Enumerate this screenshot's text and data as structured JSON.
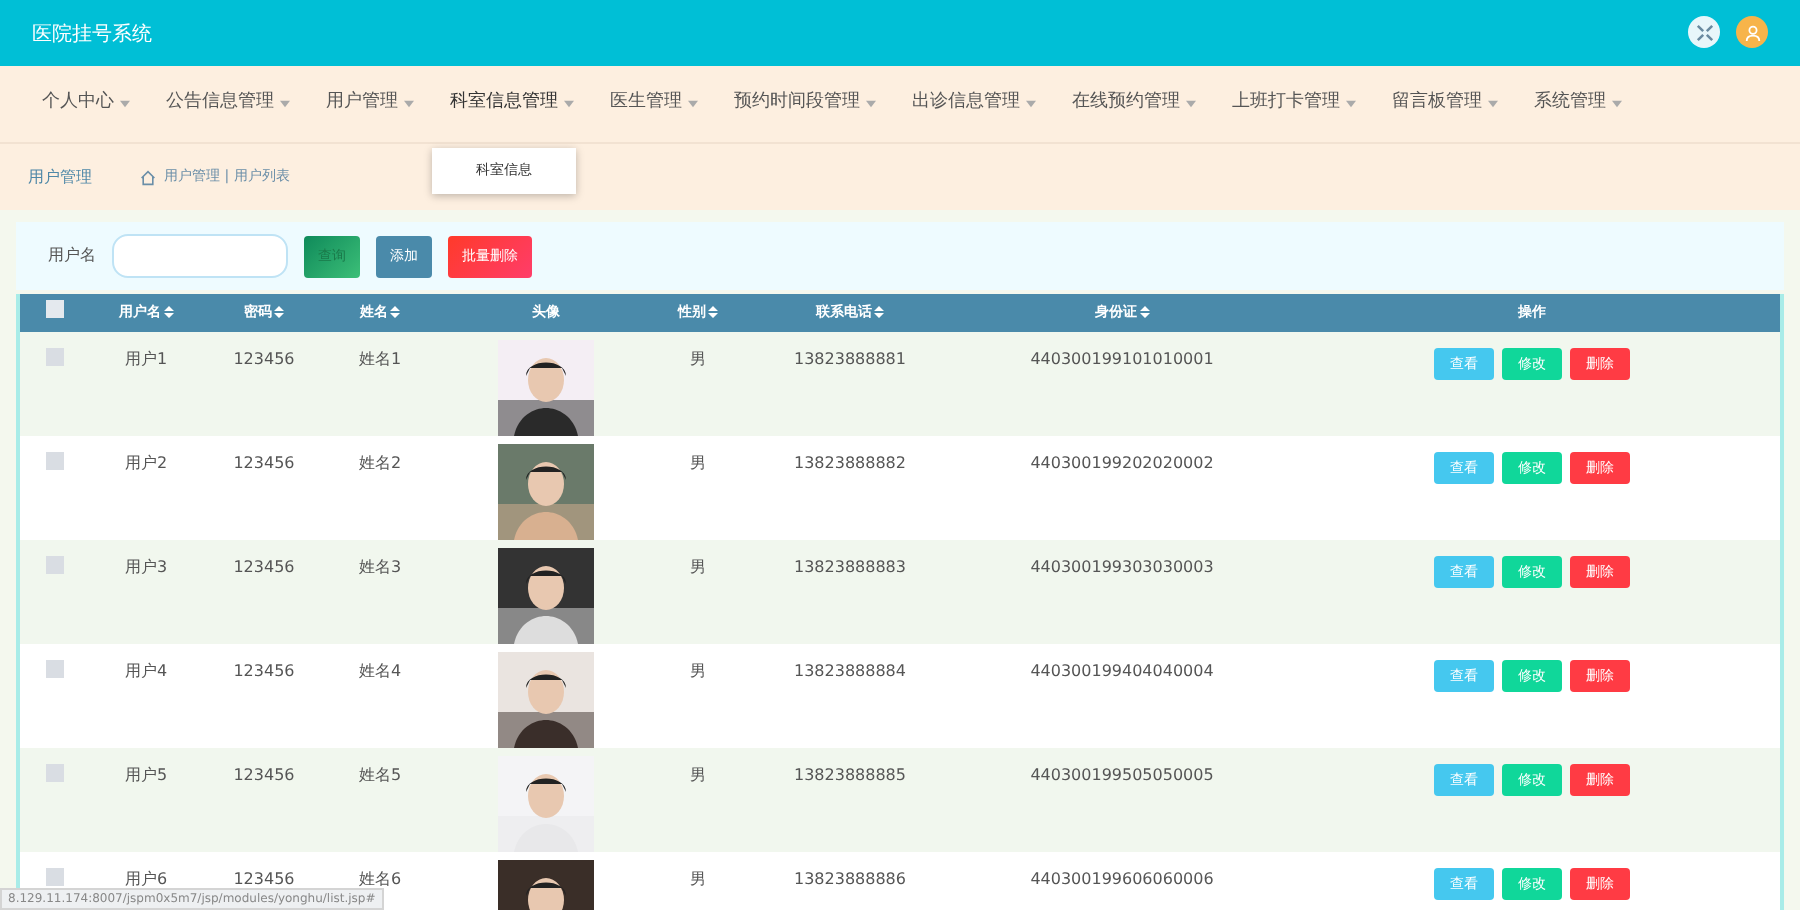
{
  "header": {
    "title": "医院挂号系统"
  },
  "nav": [
    {
      "label": "个人中心",
      "open": false
    },
    {
      "label": "公告信息管理",
      "open": false
    },
    {
      "label": "用户管理",
      "open": false
    },
    {
      "label": "科室信息管理",
      "open": true,
      "menu": [
        "科室信息"
      ]
    },
    {
      "label": "医生管理",
      "open": false
    },
    {
      "label": "预约时间段管理",
      "open": false
    },
    {
      "label": "出诊信息管理",
      "open": false
    },
    {
      "label": "在线预约管理",
      "open": false
    },
    {
      "label": "上班打卡管理",
      "open": false
    },
    {
      "label": "留言板管理",
      "open": false
    },
    {
      "label": "系统管理",
      "open": false
    }
  ],
  "breadcrumb": {
    "page_title": "用户管理",
    "path": "用户管理 | 用户列表"
  },
  "search": {
    "label": "用户名",
    "buttons": [
      {
        "label": "查询",
        "kind": "search"
      },
      {
        "label": "添加",
        "kind": "add"
      },
      {
        "label": "批量删除",
        "kind": "delete"
      }
    ]
  },
  "table": {
    "select_all": {
      "checked": false
    },
    "columns": [
      {
        "label": "用户名",
        "sortable": true
      },
      {
        "label": "密码",
        "sortable": true
      },
      {
        "label": "姓名",
        "sortable": true
      },
      {
        "label": "头像",
        "sortable": false
      },
      {
        "label": "性别",
        "sortable": true
      },
      {
        "label": "联系电话",
        "sortable": true
      },
      {
        "label": "身份证",
        "sortable": true
      },
      {
        "label": "操作",
        "sortable": false
      }
    ],
    "rows": [
      {
        "checked": false,
        "username": "用户1",
        "password": "123456",
        "name": "姓名1",
        "gender": "男",
        "phone": "13823888881",
        "id_card": "440300199101010001",
        "actions": [
          "查看",
          "修改",
          "删除"
        ]
      },
      {
        "checked": false,
        "username": "用户2",
        "password": "123456",
        "name": "姓名2",
        "gender": "男",
        "phone": "13823888882",
        "id_card": "440300199202020002",
        "actions": [
          "查看",
          "修改",
          "删除"
        ]
      },
      {
        "checked": false,
        "username": "用户3",
        "password": "123456",
        "name": "姓名3",
        "gender": "男",
        "phone": "13823888883",
        "id_card": "440300199303030003",
        "actions": [
          "查看",
          "修改",
          "删除"
        ]
      },
      {
        "checked": false,
        "username": "用户4",
        "password": "123456",
        "name": "姓名4",
        "gender": "男",
        "phone": "13823888884",
        "id_card": "440300199404040004",
        "actions": [
          "查看",
          "修改",
          "删除"
        ]
      },
      {
        "checked": false,
        "username": "用户5",
        "password": "123456",
        "name": "姓名5",
        "gender": "男",
        "phone": "13823888885",
        "id_card": "440300199505050005",
        "actions": [
          "查看",
          "修改",
          "删除"
        ]
      },
      {
        "checked": false,
        "username": "用户6",
        "password": "123456",
        "name": "姓名6",
        "gender": "男",
        "phone": "13823888886",
        "id_card": "440300199606060006",
        "actions": [
          "查看",
          "修改",
          "删除"
        ]
      }
    ]
  },
  "status_bar": {
    "url": "8.129.11.174:8007/jspm0x5m7/jsp/modules/yonghu/list.jsp#"
  }
}
